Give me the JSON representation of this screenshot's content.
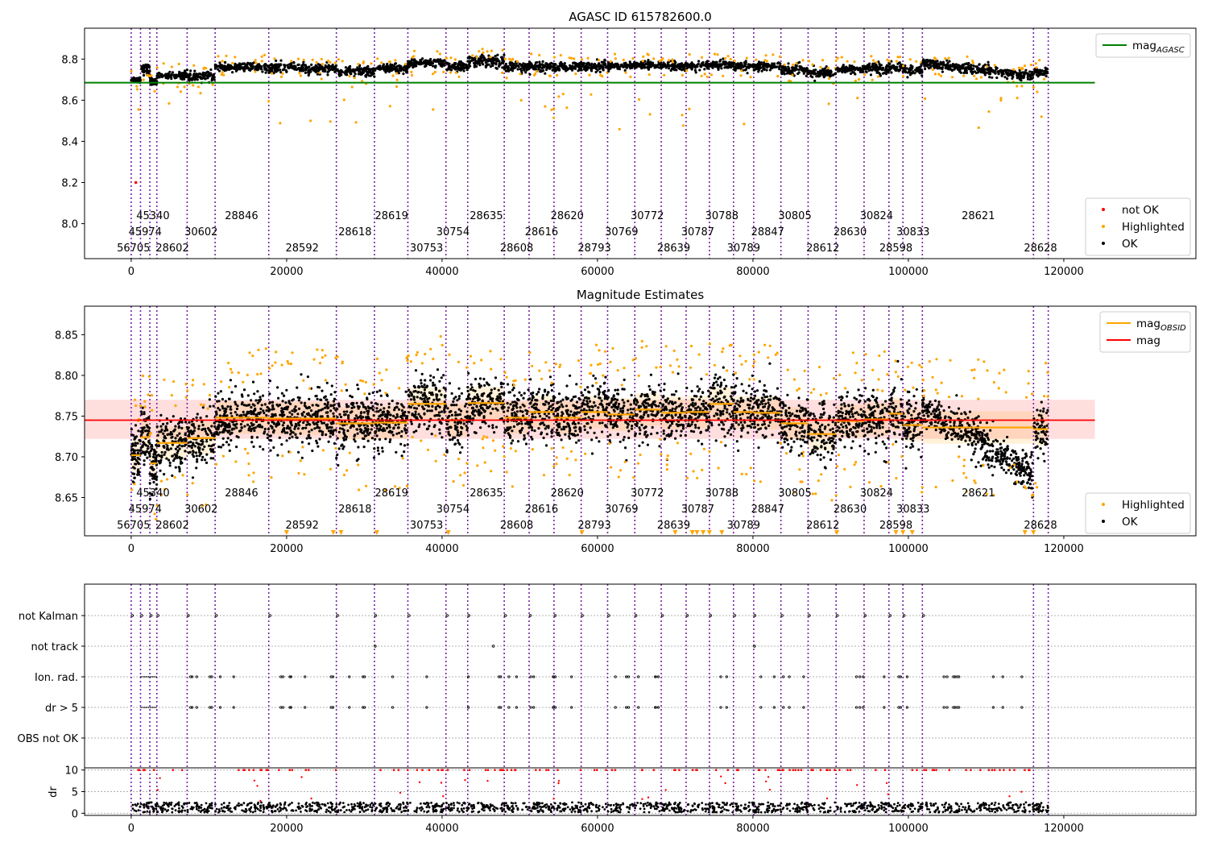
{
  "figure_title": "AGASC ID 615782600.0",
  "chart_data": [
    {
      "type": "scatter",
      "title": "AGASC ID 615782600.0",
      "xlim": [
        -6000,
        137000
      ],
      "ylim": [
        7.83,
        8.95
      ],
      "x_ticks": [
        0,
        20000,
        40000,
        60000,
        80000,
        100000,
        120000
      ],
      "y_ticks": [
        8.0,
        8.2,
        8.4,
        8.6,
        8.8
      ],
      "legend_top": [
        {
          "label": "mag",
          "subscript": "AGASC",
          "color": "#008000",
          "marker": "line"
        }
      ],
      "legend_bottom": [
        {
          "label": "not OK",
          "color": "#ff0000",
          "marker": "dot"
        },
        {
          "label": "Highlighted",
          "color": "#ffa500",
          "marker": "dot"
        },
        {
          "label": "OK",
          "color": "#000000",
          "marker": "dot"
        }
      ],
      "mag_agasc": 8.685,
      "mag_agasc_x_range": [
        -6000,
        124000
      ],
      "segments": [
        {
          "x": [
            0,
            1200
          ],
          "mean": 8.7,
          "sd": 0.008
        },
        {
          "x": [
            1200,
            2400
          ],
          "mean": 8.75,
          "sd": 0.012
        },
        {
          "x": [
            2400,
            3300
          ],
          "mean": 8.69,
          "sd": 0.01
        },
        {
          "x": [
            3300,
            7200
          ],
          "mean": 8.72,
          "sd": 0.008
        },
        {
          "x": [
            7200,
            10800
          ],
          "mean": 8.715,
          "sd": 0.012
        },
        {
          "x": [
            10800,
            17700
          ],
          "mean": 8.76,
          "sd": 0.01
        },
        {
          "x": [
            17700,
            26400
          ],
          "mean": 8.755,
          "sd": 0.012
        },
        {
          "x": [
            26400,
            31300
          ],
          "mean": 8.74,
          "sd": 0.012
        },
        {
          "x": [
            31300,
            35600
          ],
          "mean": 8.755,
          "sd": 0.01
        },
        {
          "x": [
            35600,
            40500
          ],
          "mean": 8.78,
          "sd": 0.01
        },
        {
          "x": [
            40500,
            43300
          ],
          "mean": 8.76,
          "sd": 0.012
        },
        {
          "x": [
            43300,
            48000
          ],
          "mean": 8.79,
          "sd": 0.014
        },
        {
          "x": [
            48000,
            51200
          ],
          "mean": 8.76,
          "sd": 0.012
        },
        {
          "x": [
            51200,
            54400
          ],
          "mean": 8.765,
          "sd": 0.012
        },
        {
          "x": [
            54400,
            57900
          ],
          "mean": 8.76,
          "sd": 0.012
        },
        {
          "x": [
            57900,
            61300
          ],
          "mean": 8.765,
          "sd": 0.012
        },
        {
          "x": [
            61300,
            64800
          ],
          "mean": 8.765,
          "sd": 0.01
        },
        {
          "x": [
            64800,
            68200
          ],
          "mean": 8.77,
          "sd": 0.01
        },
        {
          "x": [
            68200,
            71400
          ],
          "mean": 8.765,
          "sd": 0.012
        },
        {
          "x": [
            71400,
            74400
          ],
          "mean": 8.765,
          "sd": 0.01
        },
        {
          "x": [
            74400,
            77500
          ],
          "mean": 8.77,
          "sd": 0.01
        },
        {
          "x": [
            77500,
            80100
          ],
          "mean": 8.765,
          "sd": 0.01
        },
        {
          "x": [
            80100,
            83600
          ],
          "mean": 8.765,
          "sd": 0.01
        },
        {
          "x": [
            83600,
            87100
          ],
          "mean": 8.75,
          "sd": 0.012
        },
        {
          "x": [
            87100,
            90700
          ],
          "mean": 8.735,
          "sd": 0.012
        },
        {
          "x": [
            90700,
            94300
          ],
          "mean": 8.75,
          "sd": 0.01
        },
        {
          "x": [
            94300,
            97500
          ],
          "mean": 8.755,
          "sd": 0.012
        },
        {
          "x": [
            97500,
            99300
          ],
          "mean": 8.76,
          "sd": 0.012
        },
        {
          "x": [
            99300,
            101800
          ],
          "mean": 8.745,
          "sd": 0.012
        },
        {
          "x": [
            101800,
            116100
          ],
          "mean": 8.78,
          "sd": 0.012,
          "slope": -4.5e-06
        },
        {
          "x": [
            116100,
            118000
          ],
          "mean": 8.735,
          "sd": 0.01
        }
      ]
    },
    {
      "type": "scatter",
      "title": "Magnitude Estimates",
      "xlim": [
        -6000,
        137000
      ],
      "ylim": [
        8.603,
        8.885
      ],
      "x_ticks": [
        0,
        20000,
        40000,
        60000,
        80000,
        100000,
        120000
      ],
      "y_ticks": [
        8.65,
        8.7,
        8.75,
        8.8,
        8.85
      ],
      "legend_top": [
        {
          "label": "mag",
          "subscript": "OBSID",
          "color": "#ffa500",
          "marker": "line"
        },
        {
          "label": "mag",
          "subscript": "",
          "color": "#ff0000",
          "marker": "line"
        }
      ],
      "legend_bottom": [
        {
          "label": "Highlighted",
          "color": "#ffa500",
          "marker": "dot"
        },
        {
          "label": "OK",
          "color": "#000000",
          "marker": "dot"
        }
      ],
      "mag": 8.745,
      "mag_band": [
        8.722,
        8.77
      ],
      "mag_x_range": [
        -6000,
        124000
      ],
      "obsid_mags": [
        {
          "x": [
            0,
            1200
          ],
          "mag": 8.702
        },
        {
          "x": [
            1200,
            2400
          ],
          "mag": 8.724
        },
        {
          "x": [
            2400,
            3300
          ],
          "mag": 8.692
        },
        {
          "x": [
            3300,
            7200
          ],
          "mag": 8.717
        },
        {
          "x": [
            7200,
            10800
          ],
          "mag": 8.723
        },
        {
          "x": [
            10800,
            17700
          ],
          "mag": 8.748
        },
        {
          "x": [
            17700,
            26400
          ],
          "mag": 8.747
        },
        {
          "x": [
            26400,
            31300
          ],
          "mag": 8.741
        },
        {
          "x": [
            31300,
            35600
          ],
          "mag": 8.742
        },
        {
          "x": [
            35600,
            40500
          ],
          "mag": 8.765
        },
        {
          "x": [
            40500,
            43300
          ],
          "mag": 8.745
        },
        {
          "x": [
            43300,
            48000
          ],
          "mag": 8.766
        },
        {
          "x": [
            48000,
            51200
          ],
          "mag": 8.748
        },
        {
          "x": [
            51200,
            54400
          ],
          "mag": 8.755
        },
        {
          "x": [
            54400,
            57900
          ],
          "mag": 8.748
        },
        {
          "x": [
            57900,
            61300
          ],
          "mag": 8.755
        },
        {
          "x": [
            61300,
            64800
          ],
          "mag": 8.752
        },
        {
          "x": [
            64800,
            68200
          ],
          "mag": 8.758
        },
        {
          "x": [
            68200,
            71400
          ],
          "mag": 8.754
        },
        {
          "x": [
            71400,
            74400
          ],
          "mag": 8.755
        },
        {
          "x": [
            74400,
            77500
          ],
          "mag": 8.765
        },
        {
          "x": [
            77500,
            80100
          ],
          "mag": 8.755
        },
        {
          "x": [
            80100,
            83600
          ],
          "mag": 8.754
        },
        {
          "x": [
            83600,
            87100
          ],
          "mag": 8.741
        },
        {
          "x": [
            87100,
            90700
          ],
          "mag": 8.728
        },
        {
          "x": [
            90700,
            94300
          ],
          "mag": 8.744
        },
        {
          "x": [
            94300,
            97500
          ],
          "mag": 8.746
        },
        {
          "x": [
            97500,
            99300
          ],
          "mag": 8.753
        },
        {
          "x": [
            99300,
            101800
          ],
          "mag": 8.739
        },
        {
          "x": [
            101800,
            116100
          ],
          "mag": 8.736
        },
        {
          "x": [
            116100,
            118000
          ],
          "mag": 8.734
        }
      ]
    },
    {
      "type": "scatter",
      "title": "",
      "xlim": [
        -6000,
        137000
      ],
      "x_ticks": [
        0,
        20000,
        40000,
        60000,
        80000,
        100000,
        120000
      ],
      "flag_rows": [
        "not Kalman",
        "not track",
        "Ion. rad.",
        "dr > 5",
        "OBS not OK"
      ],
      "dr_ylabel": "dr",
      "dr_ticks": [
        0,
        5,
        10
      ],
      "dr_ylim": [
        -0.5,
        10.5
      ]
    }
  ],
  "obsid_boundaries": [
    0,
    1200,
    2400,
    3300,
    7200,
    10800,
    17700,
    26400,
    31300,
    35600,
    40500,
    43300,
    48000,
    51200,
    54400,
    57900,
    61300,
    64800,
    68200,
    71400,
    74400,
    77500,
    80100,
    83600,
    87100,
    90700,
    94300,
    97500,
    99300,
    101800,
    116100,
    118000
  ],
  "obsid_labels": [
    {
      "text": "56705",
      "x": 300,
      "row": 0
    },
    {
      "text": "45974",
      "x": 1800,
      "row": 1
    },
    {
      "text": "45340",
      "x": 2800,
      "row": 2
    },
    {
      "text": "28602",
      "x": 5300,
      "row": 0
    },
    {
      "text": "30602",
      "x": 9000,
      "row": 1
    },
    {
      "text": "28846",
      "x": 14200,
      "row": 2
    },
    {
      "text": "28592",
      "x": 22000,
      "row": 0
    },
    {
      "text": "28618",
      "x": 28800,
      "row": 1
    },
    {
      "text": "28619",
      "x": 33500,
      "row": 2
    },
    {
      "text": "30753",
      "x": 38000,
      "row": 0
    },
    {
      "text": "30754",
      "x": 41400,
      "row": 1
    },
    {
      "text": "28635",
      "x": 45700,
      "row": 2
    },
    {
      "text": "28608",
      "x": 49600,
      "row": 0
    },
    {
      "text": "28616",
      "x": 52800,
      "row": 1
    },
    {
      "text": "28620",
      "x": 56100,
      "row": 2
    },
    {
      "text": "28793",
      "x": 59600,
      "row": 0
    },
    {
      "text": "30769",
      "x": 63100,
      "row": 1
    },
    {
      "text": "30772",
      "x": 66400,
      "row": 2
    },
    {
      "text": "28639",
      "x": 69800,
      "row": 0
    },
    {
      "text": "30787",
      "x": 72900,
      "row": 1
    },
    {
      "text": "30788",
      "x": 76000,
      "row": 2
    },
    {
      "text": "30789",
      "x": 78800,
      "row": 0
    },
    {
      "text": "28847",
      "x": 81900,
      "row": 1
    },
    {
      "text": "30805",
      "x": 85400,
      "row": 2
    },
    {
      "text": "28612",
      "x": 89000,
      "row": 0
    },
    {
      "text": "28630",
      "x": 92500,
      "row": 1
    },
    {
      "text": "30824",
      "x": 95900,
      "row": 2
    },
    {
      "text": "28598",
      "x": 98400,
      "row": 0
    },
    {
      "text": "30833",
      "x": 100600,
      "row": 1
    },
    {
      "text": "28621",
      "x": 109000,
      "row": 2
    },
    {
      "text": "28628",
      "x": 117000,
      "row": 0
    }
  ]
}
